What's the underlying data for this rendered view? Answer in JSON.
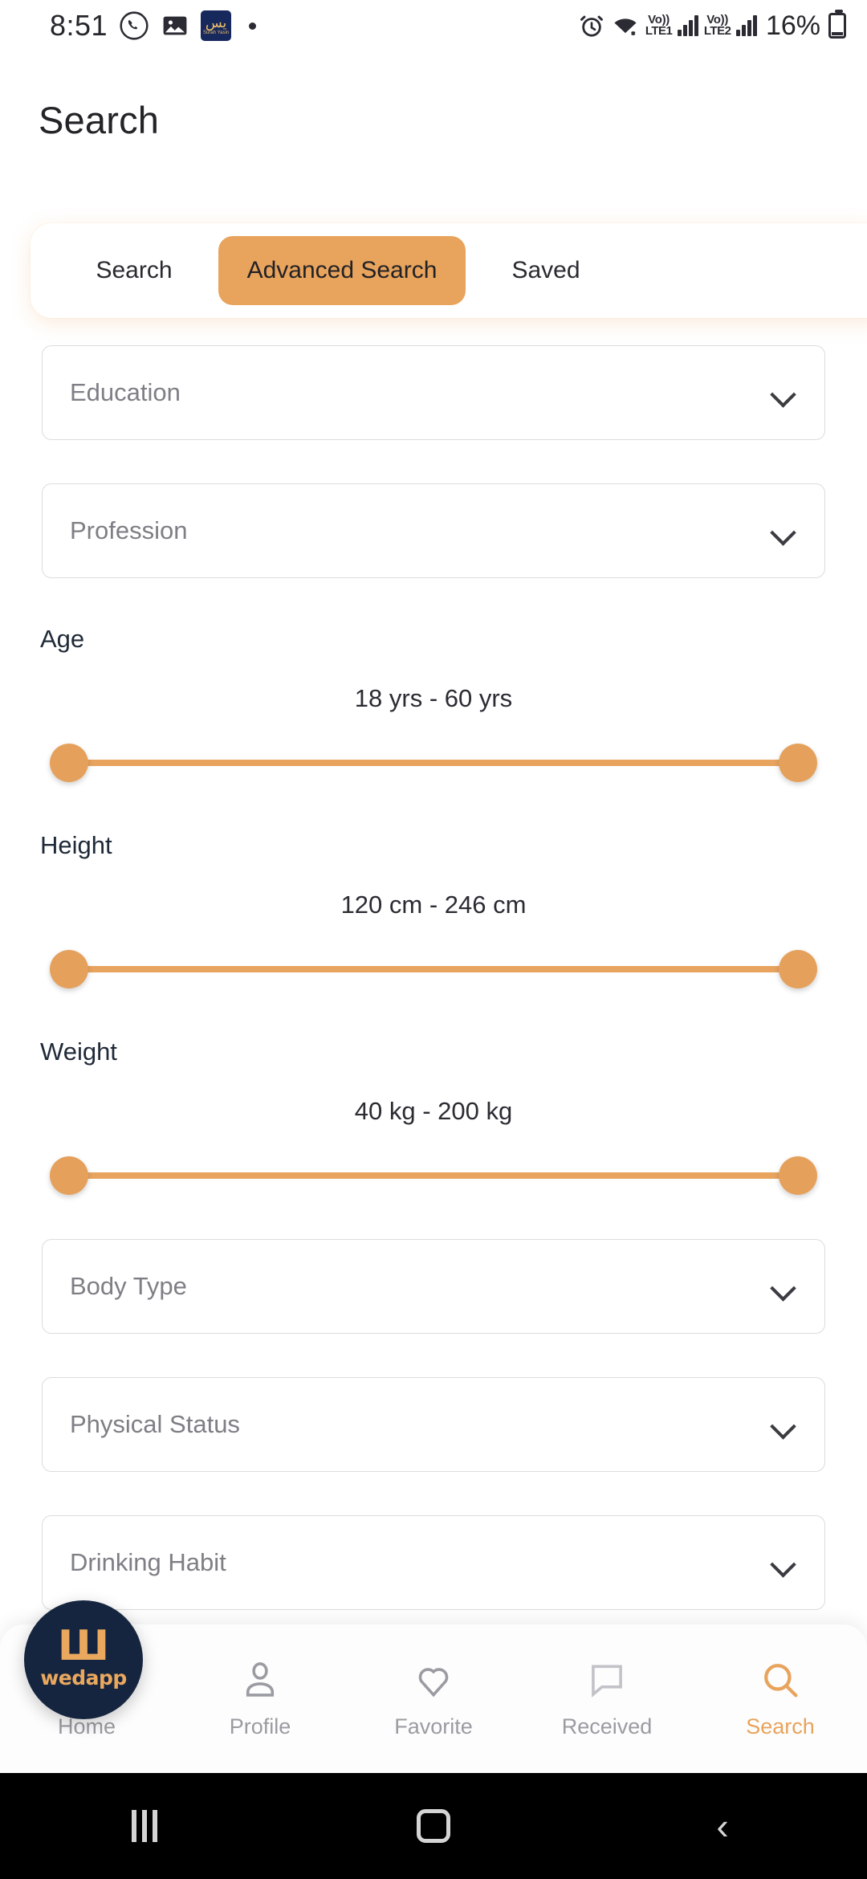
{
  "statusbar": {
    "time": "8:51",
    "app_icons": [
      "whatsapp-icon",
      "gallery-icon",
      "surah-yasin-icon"
    ],
    "yasin_label": "يس",
    "yasin_sub": "Surah Yasin",
    "alarm": "alarm-icon",
    "wifi": "wifi-icon",
    "sim1_volte": "Vo))",
    "sim1_net": "LTE1",
    "sim2_volte": "Vo))",
    "sim2_net": "LTE2",
    "battery_pct": "16%"
  },
  "header": {
    "title": "Search"
  },
  "tabs": [
    {
      "label": "Search",
      "active": false
    },
    {
      "label": "Advanced Search",
      "active": true
    },
    {
      "label": "Saved",
      "active": false
    }
  ],
  "filters": {
    "education": {
      "placeholder": "Education",
      "value": ""
    },
    "profession": {
      "placeholder": "Profession",
      "value": ""
    },
    "body_type": {
      "placeholder": "Body Type",
      "value": ""
    },
    "physical_status": {
      "placeholder": "Physical Status",
      "value": ""
    },
    "drinking_habit": {
      "placeholder": "Drinking Habit",
      "value": ""
    }
  },
  "sliders": [
    {
      "label": "Age",
      "value_text": "18 yrs - 60 yrs",
      "min": 18,
      "max": 60,
      "unit": "yrs"
    },
    {
      "label": "Height",
      "value_text": "120 cm - 246 cm",
      "min": 120,
      "max": 246,
      "unit": "cm"
    },
    {
      "label": "Weight",
      "value_text": "40 kg - 200 kg",
      "min": 40,
      "max": 200,
      "unit": "kg"
    }
  ],
  "fab": {
    "logo_mark": "Ш",
    "brand": "wedapp"
  },
  "bottom_nav": [
    {
      "label": "Home",
      "icon": "home-icon",
      "active": false
    },
    {
      "label": "Profile",
      "icon": "person-icon",
      "active": false
    },
    {
      "label": "Favorite",
      "icon": "heart-icon",
      "active": false
    },
    {
      "label": "Received",
      "icon": "chat-icon",
      "active": false
    },
    {
      "label": "Search",
      "icon": "search-icon",
      "active": true
    }
  ],
  "android_nav": {
    "recents": "recents-button",
    "home": "home-button",
    "back": "back-button"
  },
  "colors": {
    "accent": "#e8a35c",
    "accent_track": "#e8a45e",
    "fab_bg": "#16253f",
    "text_dark": "#232328",
    "placeholder": "#7e7e85",
    "nav_inactive": "#9b9ba2"
  }
}
